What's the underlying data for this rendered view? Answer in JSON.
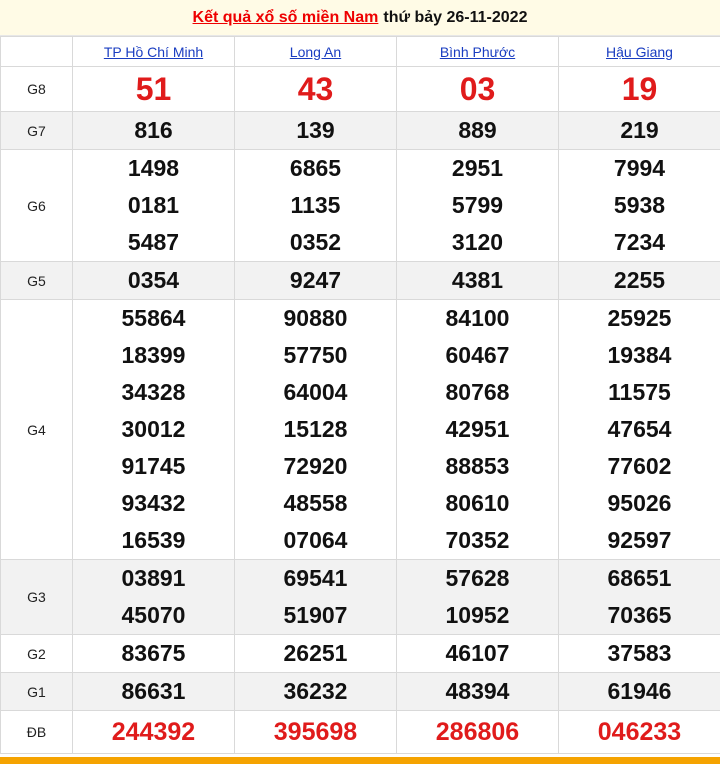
{
  "header": {
    "title_link": "Kết quả xổ số miền Nam",
    "date_text": "thứ bảy 26-11-2022"
  },
  "provinces": [
    "TP Hồ Chí Minh",
    "Long An",
    "Bình Phước",
    "Hậu Giang"
  ],
  "prizes": [
    {
      "label": "G8",
      "values": [
        [
          "51"
        ],
        [
          "43"
        ],
        [
          "03"
        ],
        [
          "19"
        ]
      ]
    },
    {
      "label": "G7",
      "values": [
        [
          "816"
        ],
        [
          "139"
        ],
        [
          "889"
        ],
        [
          "219"
        ]
      ]
    },
    {
      "label": "G6",
      "values": [
        [
          "1498",
          "0181",
          "5487"
        ],
        [
          "6865",
          "1135",
          "0352"
        ],
        [
          "2951",
          "5799",
          "3120"
        ],
        [
          "7994",
          "5938",
          "7234"
        ]
      ]
    },
    {
      "label": "G5",
      "values": [
        [
          "0354"
        ],
        [
          "9247"
        ],
        [
          "4381"
        ],
        [
          "2255"
        ]
      ]
    },
    {
      "label": "G4",
      "values": [
        [
          "55864",
          "18399",
          "34328",
          "30012",
          "91745",
          "93432",
          "16539"
        ],
        [
          "90880",
          "57750",
          "64004",
          "15128",
          "72920",
          "48558",
          "07064"
        ],
        [
          "84100",
          "60467",
          "80768",
          "42951",
          "88853",
          "80610",
          "70352"
        ],
        [
          "25925",
          "19384",
          "11575",
          "47654",
          "77602",
          "95026",
          "92597"
        ]
      ]
    },
    {
      "label": "G3",
      "values": [
        [
          "03891",
          "45070"
        ],
        [
          "69541",
          "51907"
        ],
        [
          "57628",
          "10952"
        ],
        [
          "68651",
          "70365"
        ]
      ]
    },
    {
      "label": "G2",
      "values": [
        [
          "83675"
        ],
        [
          "26251"
        ],
        [
          "46107"
        ],
        [
          "37583"
        ]
      ]
    },
    {
      "label": "G1",
      "values": [
        [
          "86631"
        ],
        [
          "36232"
        ],
        [
          "48394"
        ],
        [
          "61946"
        ]
      ]
    },
    {
      "label": "ĐB",
      "values": [
        [
          "244392"
        ],
        [
          "395698"
        ],
        [
          "286806"
        ],
        [
          "046233"
        ]
      ]
    }
  ],
  "colors": {
    "accent_red": "#e01b1b",
    "link_blue": "#1a3dc1",
    "bottom_bar": "#f5a300",
    "alt_row_bg": "#f2f2f2"
  }
}
